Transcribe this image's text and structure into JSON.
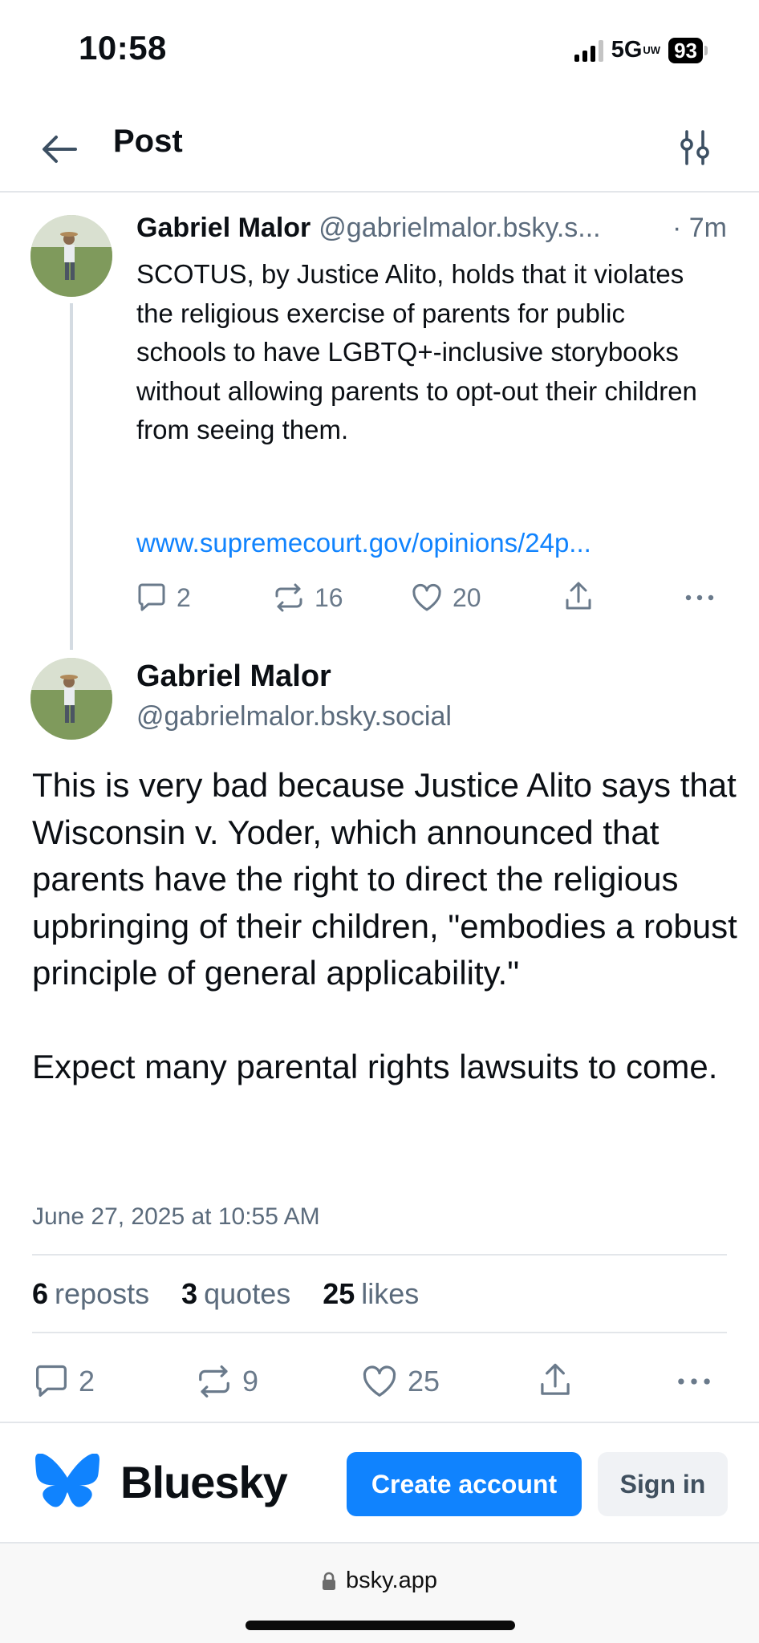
{
  "status_bar": {
    "time": "10:58",
    "network": "5G",
    "network_suffix": "UW",
    "battery": "93"
  },
  "header": {
    "title": "Post"
  },
  "parent_post": {
    "author_name": "Gabriel Malor",
    "handle": "@gabrielmalor.bsky.s...",
    "time": "· 7m",
    "text": "SCOTUS, by Justice Alito, holds that it violates the religious exercise of parents for public schools to have LGBTQ+-inclusive storybooks without allowing parents to opt-out their children from seeing them.",
    "link": "www.supremecourt.gov/opinions/24p...",
    "replies": "2",
    "reposts": "16",
    "likes": "20"
  },
  "main_post": {
    "author_name": "Gabriel Malor",
    "handle": "@gabrielmalor.bsky.social",
    "text": "This is very bad because Justice Alito says that Wisconsin v. Yoder, which announced that parents have the right to direct the religious upbringing of their children, \"embodies a robust principle of general applicability.\"\n\nExpect many parental rights lawsuits to come.",
    "date": "June 27, 2025 at 10:55 AM",
    "stats": {
      "reposts_count": "6",
      "reposts_label": "reposts",
      "quotes_count": "3",
      "quotes_label": "quotes",
      "likes_count": "25",
      "likes_label": "likes"
    },
    "replies": "2",
    "reposts": "9",
    "likes": "25"
  },
  "bottom_bar": {
    "brand": "Bluesky",
    "create_account": "Create account",
    "sign_in": "Sign in"
  },
  "browser": {
    "url": "bsky.app"
  },
  "colors": {
    "accent": "#1083fe",
    "muted_text": "#5b6b7c",
    "icon_gray": "#6a7a8b",
    "divider": "#e3e6ea"
  },
  "icons": [
    "back-arrow-icon",
    "filter-sliders-icon",
    "reply-icon",
    "repost-icon",
    "like-icon",
    "share-icon",
    "more-icon",
    "butterfly-logo-icon",
    "lock-icon"
  ]
}
